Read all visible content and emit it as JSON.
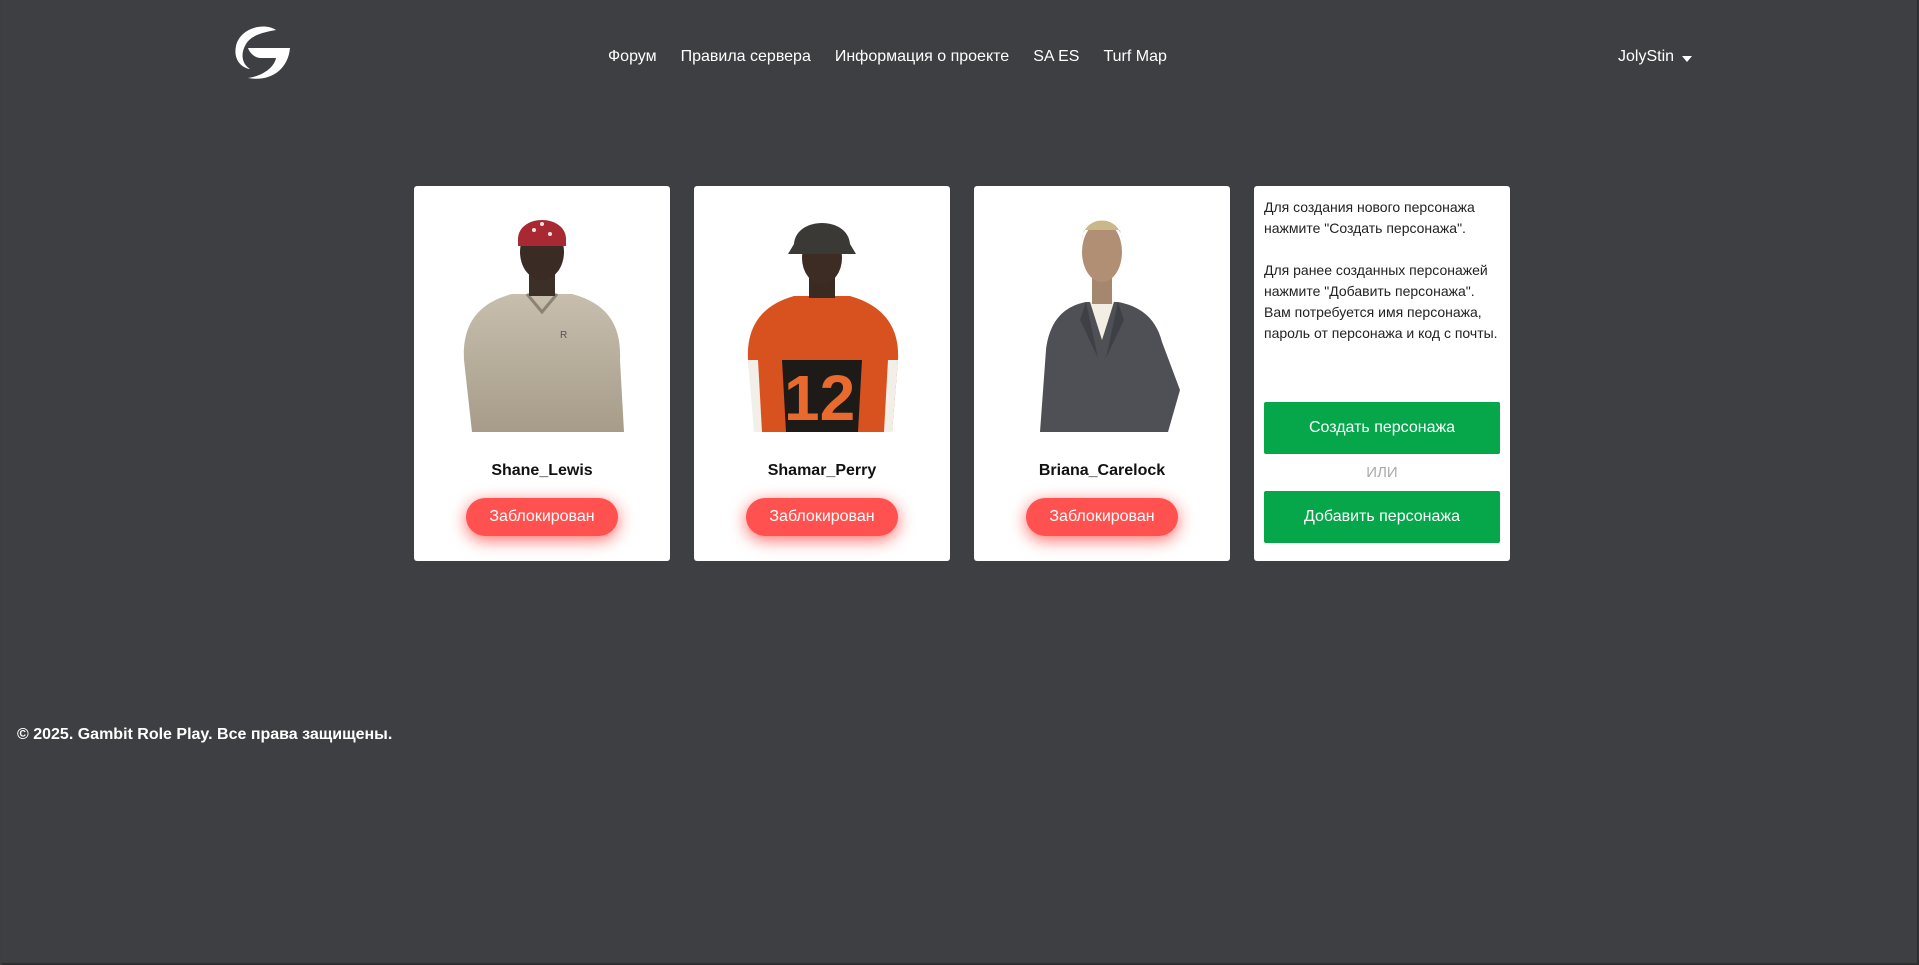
{
  "nav": {
    "items": [
      "Форум",
      "Правила сервера",
      "Информация о проекте",
      "SA ES",
      "Turf Map"
    ]
  },
  "user": {
    "name": "JolyStin",
    "icon": "chevron-down-icon"
  },
  "characters": [
    {
      "name": "Shane_Lewis",
      "status": "Заблокирован"
    },
    {
      "name": "Shamar_Perry",
      "status": "Заблокирован"
    },
    {
      "name": "Briana_Carelock",
      "status": "Заблокирован"
    }
  ],
  "info": {
    "text1": "Для создания нового персонажа нажмите \"Создать персонажа\".",
    "text2": "Для ранее созданных персонажей нажмите \"Добавить персонажа\". Вам потребуется имя персонажа, пароль от персонажа и код с почты.",
    "create_label": "Создать персонажа",
    "or_label": "ИЛИ",
    "add_label": "Добавить персонажа"
  },
  "footer": {
    "text": "© 2025. Gambit Role Play. Все права защищены."
  },
  "colors": {
    "background": "#3e3f42",
    "blocked": "#ff5250",
    "green": "#05a74a"
  }
}
